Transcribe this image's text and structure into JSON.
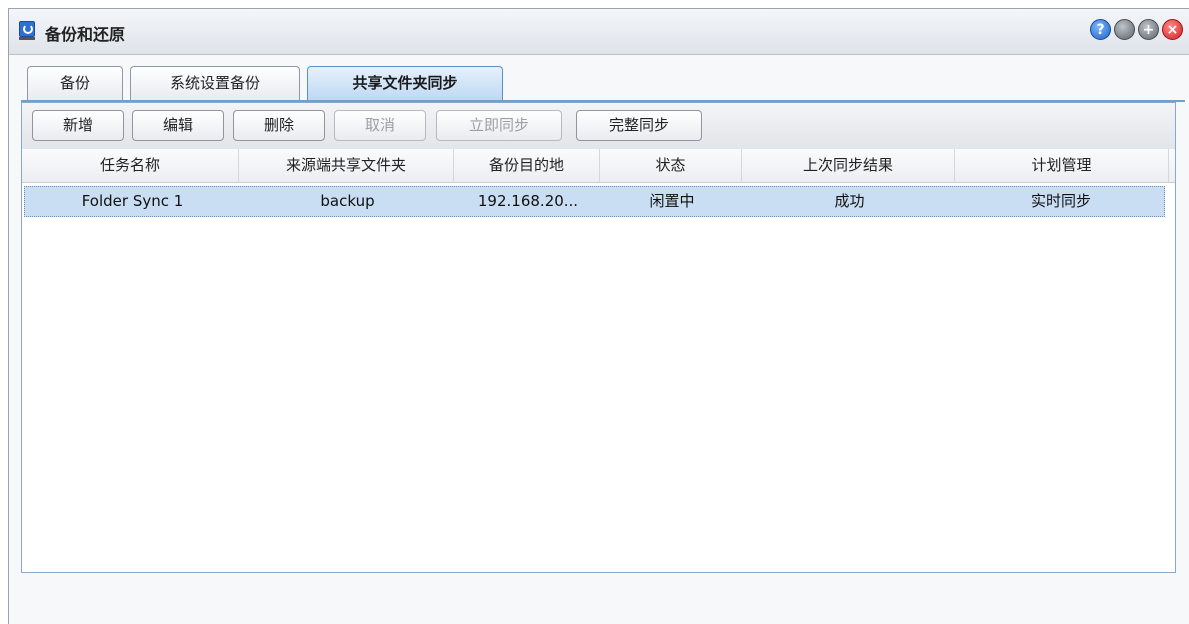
{
  "window": {
    "title": "备份和还原",
    "icon": "backup-restore-icon",
    "controls": [
      "help-icon",
      "minimize-icon",
      "maximize-icon",
      "close-icon"
    ],
    "help_glyph": "?",
    "max_glyph": "+",
    "close_glyph": "×"
  },
  "tabs": [
    {
      "label": "备份"
    },
    {
      "label": "系统设置备份"
    },
    {
      "label": "共享文件夹同步",
      "active": true
    }
  ],
  "toolbar": {
    "add_label": "新增",
    "edit_label": "编辑",
    "delete_label": "删除",
    "cancel_label": "取消",
    "sync_now_label": "立即同步",
    "full_sync_label": "完整同步"
  },
  "table": {
    "columns": [
      "任务名称",
      "来源端共享文件夹",
      "备份目的地",
      "状态",
      "上次同步结果",
      "计划管理"
    ],
    "rows": [
      [
        "Folder Sync 1",
        "backup",
        "192.168.20...",
        "闲置中",
        "成功",
        "实时同步"
      ]
    ]
  },
  "colors": {
    "accent": "#5b8fc7",
    "selected_row": "#c9def3",
    "close": "#d21f1f",
    "help": "#1f63c4"
  }
}
